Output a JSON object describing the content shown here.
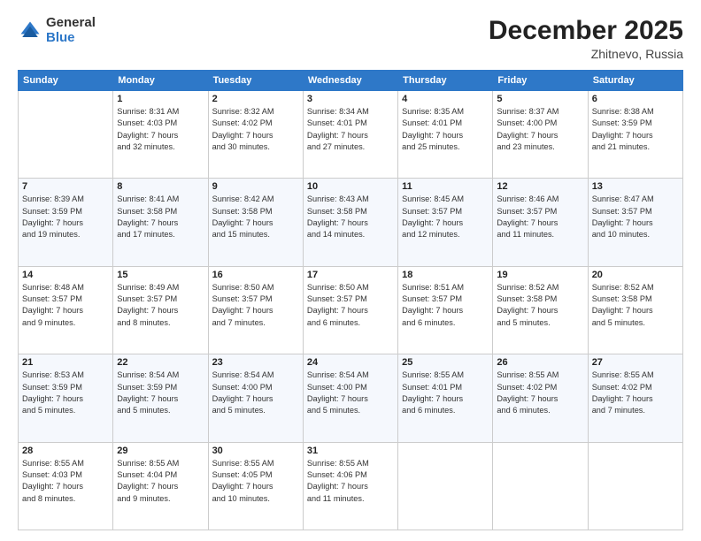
{
  "logo": {
    "general": "General",
    "blue": "Blue"
  },
  "header": {
    "month": "December 2025",
    "location": "Zhitnevo, Russia"
  },
  "days_of_week": [
    "Sunday",
    "Monday",
    "Tuesday",
    "Wednesday",
    "Thursday",
    "Friday",
    "Saturday"
  ],
  "weeks": [
    [
      {
        "day": "",
        "info": ""
      },
      {
        "day": "1",
        "info": "Sunrise: 8:31 AM\nSunset: 4:03 PM\nDaylight: 7 hours\nand 32 minutes."
      },
      {
        "day": "2",
        "info": "Sunrise: 8:32 AM\nSunset: 4:02 PM\nDaylight: 7 hours\nand 30 minutes."
      },
      {
        "day": "3",
        "info": "Sunrise: 8:34 AM\nSunset: 4:01 PM\nDaylight: 7 hours\nand 27 minutes."
      },
      {
        "day": "4",
        "info": "Sunrise: 8:35 AM\nSunset: 4:01 PM\nDaylight: 7 hours\nand 25 minutes."
      },
      {
        "day": "5",
        "info": "Sunrise: 8:37 AM\nSunset: 4:00 PM\nDaylight: 7 hours\nand 23 minutes."
      },
      {
        "day": "6",
        "info": "Sunrise: 8:38 AM\nSunset: 3:59 PM\nDaylight: 7 hours\nand 21 minutes."
      }
    ],
    [
      {
        "day": "7",
        "info": "Sunrise: 8:39 AM\nSunset: 3:59 PM\nDaylight: 7 hours\nand 19 minutes."
      },
      {
        "day": "8",
        "info": "Sunrise: 8:41 AM\nSunset: 3:58 PM\nDaylight: 7 hours\nand 17 minutes."
      },
      {
        "day": "9",
        "info": "Sunrise: 8:42 AM\nSunset: 3:58 PM\nDaylight: 7 hours\nand 15 minutes."
      },
      {
        "day": "10",
        "info": "Sunrise: 8:43 AM\nSunset: 3:58 PM\nDaylight: 7 hours\nand 14 minutes."
      },
      {
        "day": "11",
        "info": "Sunrise: 8:45 AM\nSunset: 3:57 PM\nDaylight: 7 hours\nand 12 minutes."
      },
      {
        "day": "12",
        "info": "Sunrise: 8:46 AM\nSunset: 3:57 PM\nDaylight: 7 hours\nand 11 minutes."
      },
      {
        "day": "13",
        "info": "Sunrise: 8:47 AM\nSunset: 3:57 PM\nDaylight: 7 hours\nand 10 minutes."
      }
    ],
    [
      {
        "day": "14",
        "info": "Sunrise: 8:48 AM\nSunset: 3:57 PM\nDaylight: 7 hours\nand 9 minutes."
      },
      {
        "day": "15",
        "info": "Sunrise: 8:49 AM\nSunset: 3:57 PM\nDaylight: 7 hours\nand 8 minutes."
      },
      {
        "day": "16",
        "info": "Sunrise: 8:50 AM\nSunset: 3:57 PM\nDaylight: 7 hours\nand 7 minutes."
      },
      {
        "day": "17",
        "info": "Sunrise: 8:50 AM\nSunset: 3:57 PM\nDaylight: 7 hours\nand 6 minutes."
      },
      {
        "day": "18",
        "info": "Sunrise: 8:51 AM\nSunset: 3:57 PM\nDaylight: 7 hours\nand 6 minutes."
      },
      {
        "day": "19",
        "info": "Sunrise: 8:52 AM\nSunset: 3:58 PM\nDaylight: 7 hours\nand 5 minutes."
      },
      {
        "day": "20",
        "info": "Sunrise: 8:52 AM\nSunset: 3:58 PM\nDaylight: 7 hours\nand 5 minutes."
      }
    ],
    [
      {
        "day": "21",
        "info": "Sunrise: 8:53 AM\nSunset: 3:59 PM\nDaylight: 7 hours\nand 5 minutes."
      },
      {
        "day": "22",
        "info": "Sunrise: 8:54 AM\nSunset: 3:59 PM\nDaylight: 7 hours\nand 5 minutes."
      },
      {
        "day": "23",
        "info": "Sunrise: 8:54 AM\nSunset: 4:00 PM\nDaylight: 7 hours\nand 5 minutes."
      },
      {
        "day": "24",
        "info": "Sunrise: 8:54 AM\nSunset: 4:00 PM\nDaylight: 7 hours\nand 5 minutes."
      },
      {
        "day": "25",
        "info": "Sunrise: 8:55 AM\nSunset: 4:01 PM\nDaylight: 7 hours\nand 6 minutes."
      },
      {
        "day": "26",
        "info": "Sunrise: 8:55 AM\nSunset: 4:02 PM\nDaylight: 7 hours\nand 6 minutes."
      },
      {
        "day": "27",
        "info": "Sunrise: 8:55 AM\nSunset: 4:02 PM\nDaylight: 7 hours\nand 7 minutes."
      }
    ],
    [
      {
        "day": "28",
        "info": "Sunrise: 8:55 AM\nSunset: 4:03 PM\nDaylight: 7 hours\nand 8 minutes."
      },
      {
        "day": "29",
        "info": "Sunrise: 8:55 AM\nSunset: 4:04 PM\nDaylight: 7 hours\nand 9 minutes."
      },
      {
        "day": "30",
        "info": "Sunrise: 8:55 AM\nSunset: 4:05 PM\nDaylight: 7 hours\nand 10 minutes."
      },
      {
        "day": "31",
        "info": "Sunrise: 8:55 AM\nSunset: 4:06 PM\nDaylight: 7 hours\nand 11 minutes."
      },
      {
        "day": "",
        "info": ""
      },
      {
        "day": "",
        "info": ""
      },
      {
        "day": "",
        "info": ""
      }
    ]
  ]
}
